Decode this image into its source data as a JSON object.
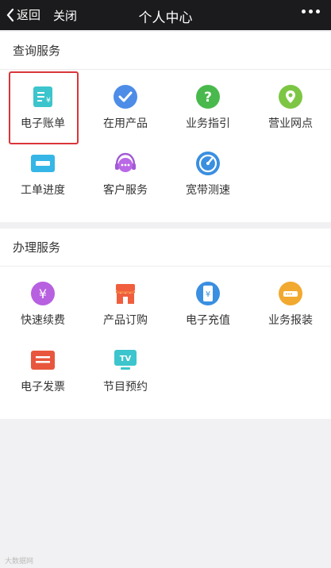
{
  "topbar": {
    "back_label": "返回",
    "close_label": "关闭",
    "title": "个人中心"
  },
  "query_section": {
    "title": "查询服务",
    "items": [
      {
        "label": "电子账单",
        "icon": "bill-icon"
      },
      {
        "label": "在用产品",
        "icon": "check-circle-icon"
      },
      {
        "label": "业务指引",
        "icon": "question-icon"
      },
      {
        "label": "营业网点",
        "icon": "location-pin-icon"
      },
      {
        "label": "工单进度",
        "icon": "progress-bar-icon"
      },
      {
        "label": "客户服务",
        "icon": "headset-chat-icon"
      },
      {
        "label": "宽带测速",
        "icon": "speedometer-icon"
      }
    ]
  },
  "handle_section": {
    "title": "办理服务",
    "items": [
      {
        "label": "快速续费",
        "icon": "yuan-coin-icon"
      },
      {
        "label": "产品订购",
        "icon": "store-icon"
      },
      {
        "label": "电子充值",
        "icon": "phone-yuan-icon"
      },
      {
        "label": "业务报装",
        "icon": "router-icon"
      },
      {
        "label": "电子发票",
        "icon": "invoice-icon"
      },
      {
        "label": "节目预约",
        "icon": "tv-icon"
      }
    ]
  },
  "watermark": "大数据网",
  "colors": {
    "topbar": "#1b1b1d",
    "highlight_border": "#d9363a",
    "page_bg": "#f1f1f3"
  }
}
